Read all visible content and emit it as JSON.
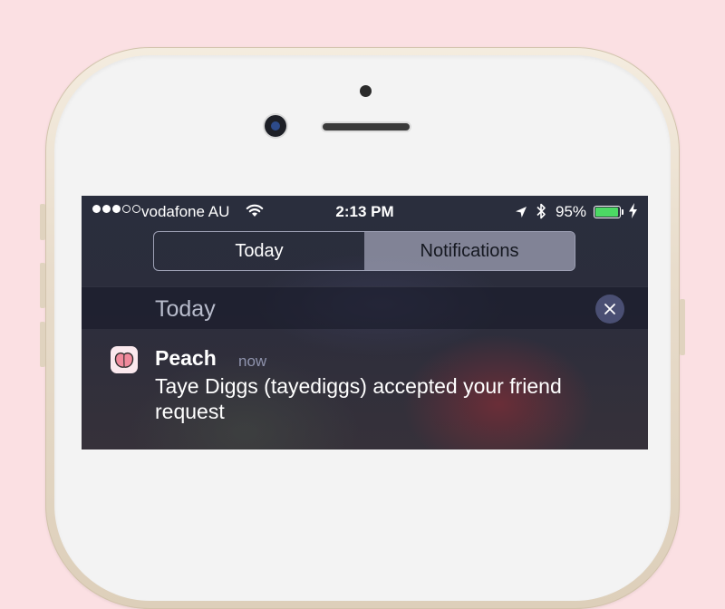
{
  "status_bar": {
    "signal_dots": [
      true,
      true,
      true,
      false,
      false
    ],
    "carrier": "vodafone AU",
    "time": "2:13 PM",
    "battery_percent": "95%",
    "battery_level": 0.95,
    "battery_color": "#4cd964",
    "icons": [
      "wifi-icon",
      "location-arrow-icon",
      "bluetooth-icon",
      "battery-icon",
      "charging-bolt-icon"
    ]
  },
  "segmented_control": {
    "tabs": [
      {
        "label": "Today",
        "selected": false
      },
      {
        "label": "Notifications",
        "selected": true
      }
    ]
  },
  "section": {
    "title": "Today",
    "clear_icon": "close-icon"
  },
  "notification": {
    "app_icon": "peach-app-icon",
    "app_name": "Peach",
    "time": "now",
    "message": "Taye Diggs (tayediggs) accepted your friend request"
  },
  "colors": {
    "background": "#fbe0e3",
    "phone_frame": "#e8dccb",
    "selected_tab": "#c8cae0",
    "clear_button": "#4a4f73"
  }
}
